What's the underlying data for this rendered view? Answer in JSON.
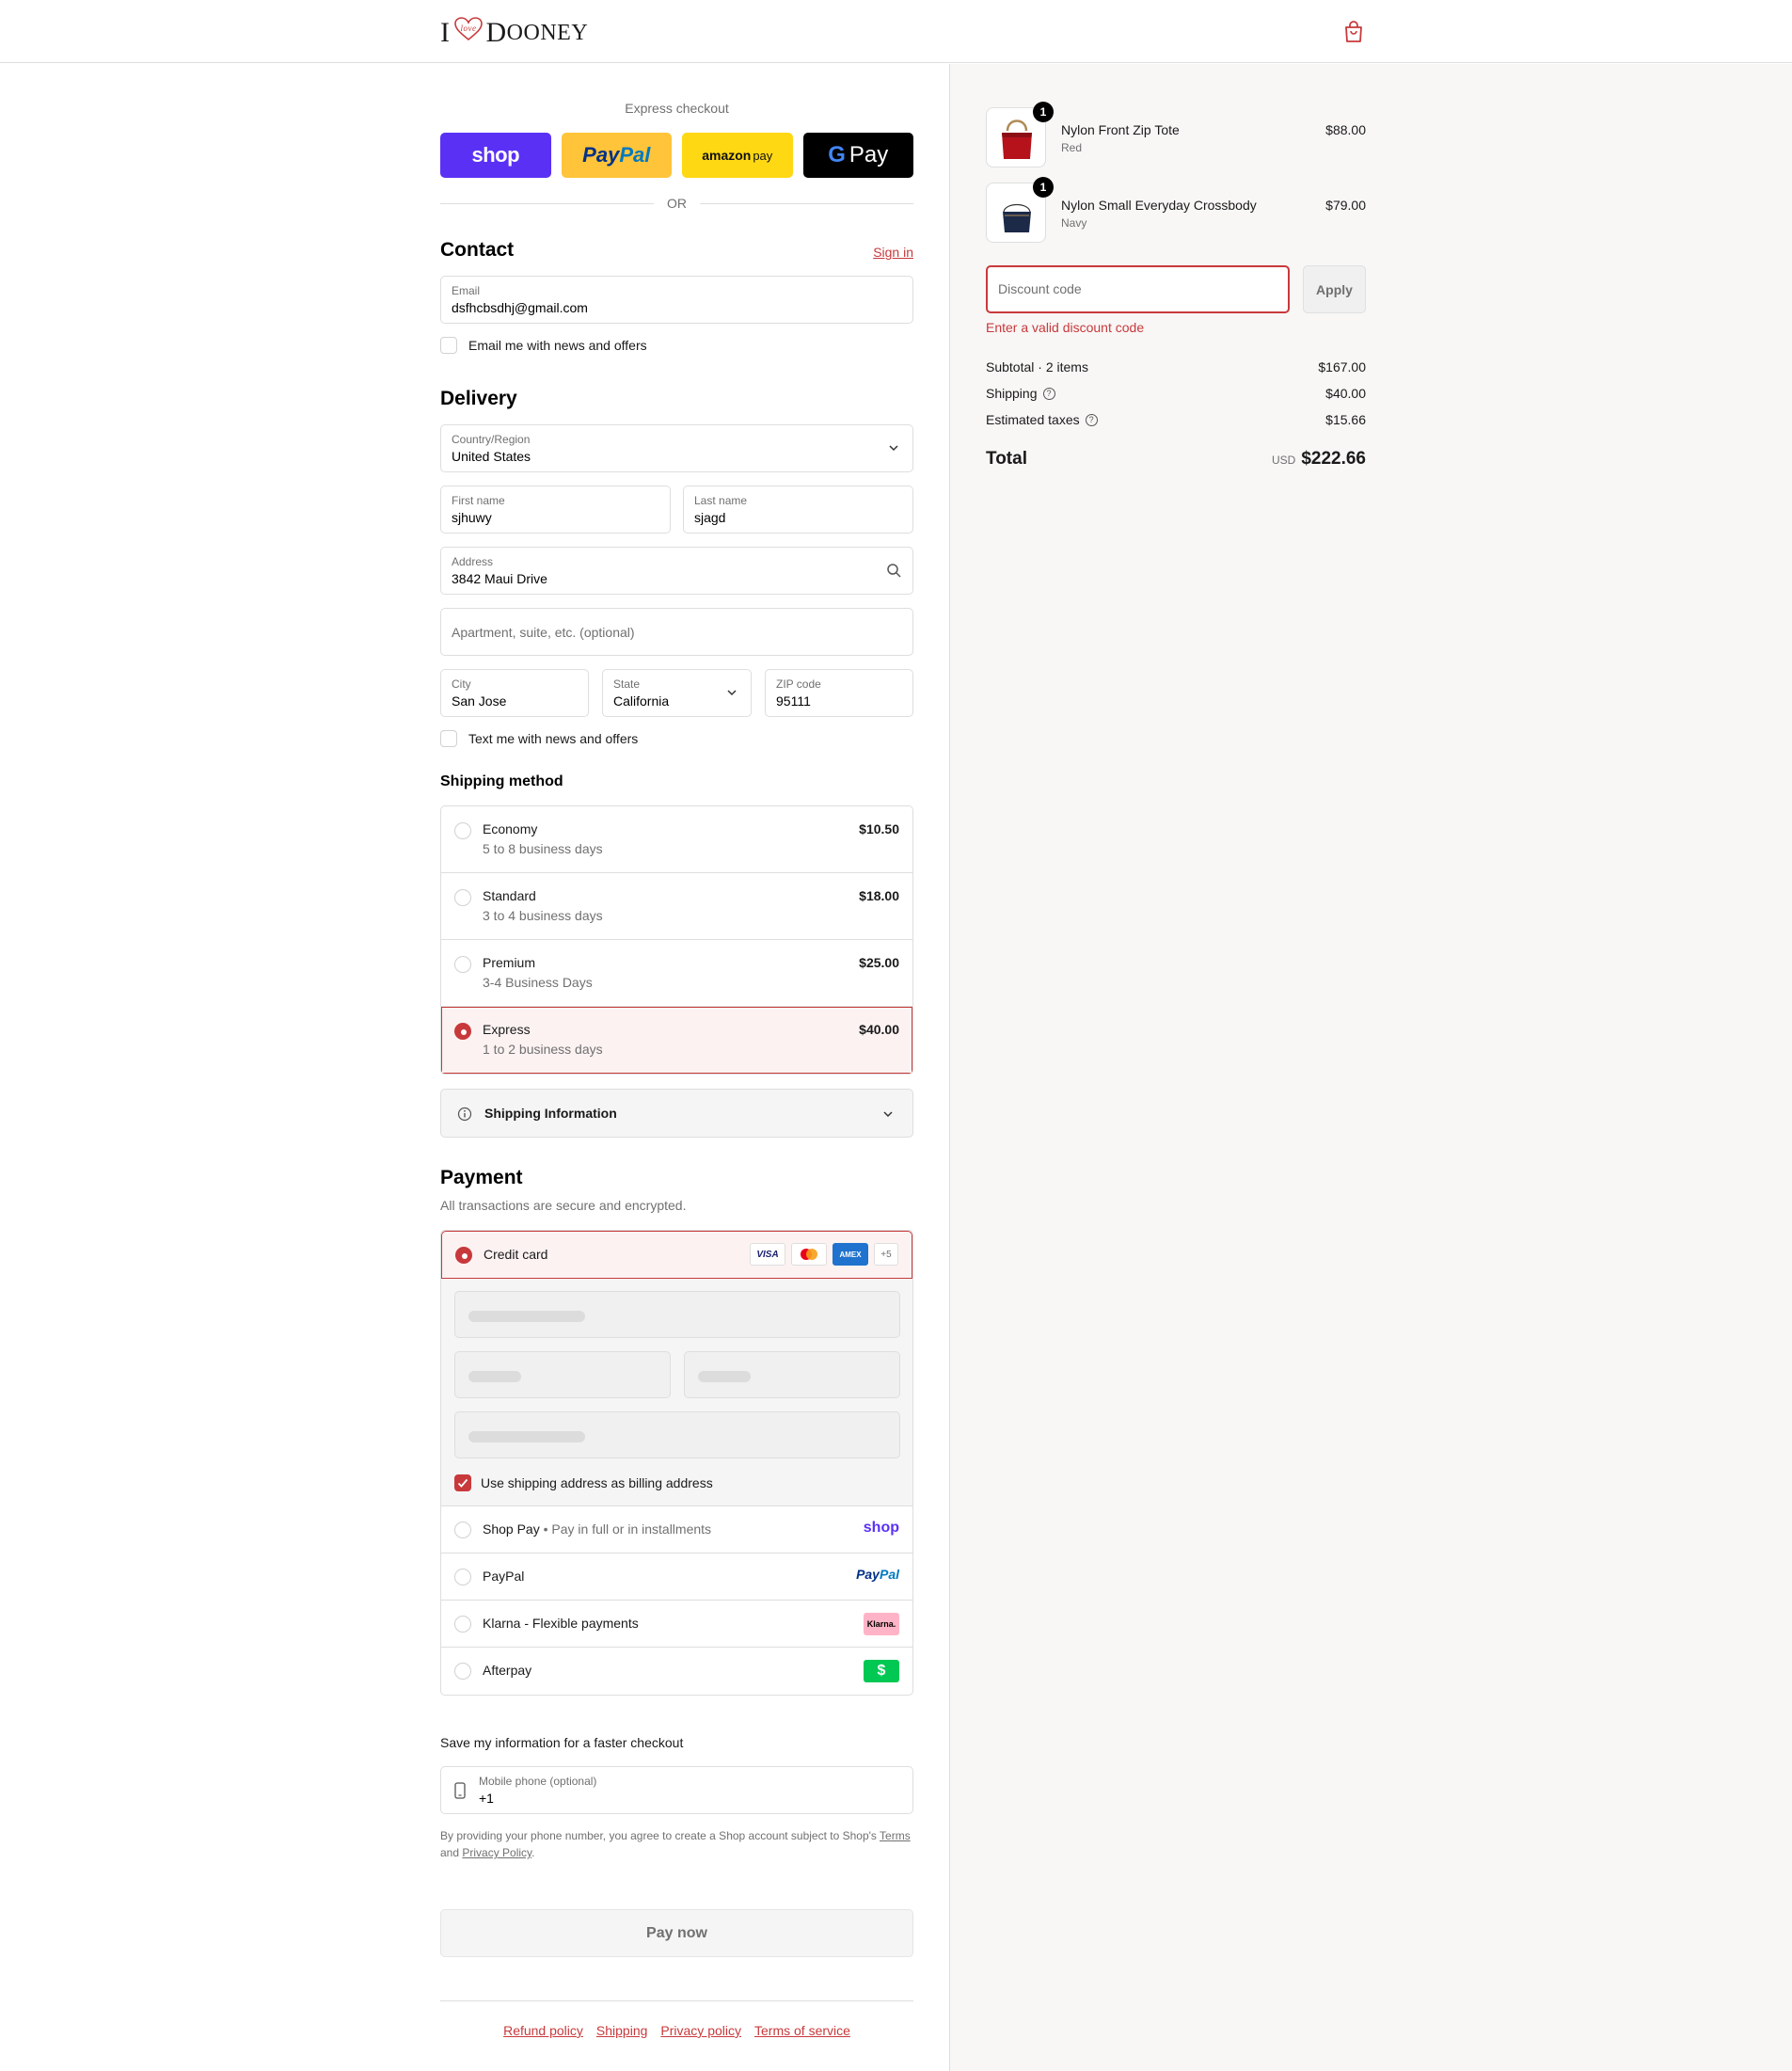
{
  "header": {
    "logo_i": "I",
    "logo_name_first": "D",
    "logo_name_rest": "OONEY",
    "heart_text": "love"
  },
  "express": {
    "title": "Express checkout",
    "shop_label": "shop",
    "paypal_pay": "Pay",
    "paypal_pal": "Pal",
    "amazon_label": "amazon",
    "amazon_pay": "pay",
    "gpay_g": "G",
    "gpay_label": "Pay",
    "or_label": "OR"
  },
  "contact": {
    "title": "Contact",
    "sign_in": "Sign in",
    "email_label": "Email",
    "email_value": "dsfhcbsdhj@gmail.com",
    "news_label": "Email me with news and offers"
  },
  "delivery": {
    "title": "Delivery",
    "country_label": "Country/Region",
    "country_value": "United States",
    "first_label": "First name",
    "first_value": "sjhuwy",
    "last_label": "Last name",
    "last_value": "sjagd",
    "address_label": "Address",
    "address_value": "3842 Maui Drive",
    "apt_placeholder": "Apartment, suite, etc. (optional)",
    "city_label": "City",
    "city_value": "San Jose",
    "state_label": "State",
    "state_value": "California",
    "zip_label": "ZIP code",
    "zip_value": "95111",
    "text_label": "Text me with news and offers"
  },
  "shipping": {
    "title": "Shipping method",
    "options": [
      {
        "name": "Economy",
        "sub": "5 to 8 business days",
        "price": "$10.50"
      },
      {
        "name": "Standard",
        "sub": "3 to 4 business days",
        "price": "$18.00"
      },
      {
        "name": "Premium",
        "sub": "3-4 Business Days",
        "price": "$25.00"
      },
      {
        "name": "Express",
        "sub": "1 to 2 business days",
        "price": "$40.00"
      }
    ],
    "info_label": "Shipping Information"
  },
  "payment": {
    "title": "Payment",
    "subtitle": "All transactions are secure and encrypted.",
    "cc_label": "Credit card",
    "card_visa": "VISA",
    "card_amex": "AMEX",
    "card_more": "+5",
    "billing_label": "Use shipping address as billing address",
    "shoppay_label": "Shop Pay",
    "shoppay_sep": " • ",
    "shoppay_sub": "Pay in full or in installments",
    "shoppay_logo": "shop",
    "paypal_label": "PayPal",
    "paypal_logo_pay": "Pay",
    "paypal_logo_pal": "Pal",
    "klarna_label": "Klarna - Flexible payments",
    "klarna_logo": "Klarna.",
    "afterpay_label": "Afterpay",
    "afterpay_logo": "$"
  },
  "save": {
    "title": "Save my information for a faster checkout",
    "phone_label": "Mobile phone (optional)",
    "phone_value": "+1",
    "disclaimer_pre": "By providing your phone number, you agree to create a Shop account subject to Shop's ",
    "terms": "Terms",
    "and": "and ",
    "privacy": "Privacy Policy",
    "period": "."
  },
  "pay_now": "Pay now",
  "footer": [
    "Refund policy",
    "Shipping",
    "Privacy policy",
    "Terms of service"
  ],
  "cart": {
    "items": [
      {
        "qty": "1",
        "name": "Nylon Front Zip Tote",
        "variant": "Red",
        "price": "$88.00"
      },
      {
        "qty": "1",
        "name": "Nylon Small Everyday Crossbody",
        "variant": "Navy",
        "price": "$79.00"
      }
    ],
    "discount_placeholder": "Discount code",
    "apply": "Apply",
    "discount_error": "Enter a valid discount code",
    "subtotal_label": "Subtotal · 2 items",
    "subtotal": "$167.00",
    "shipping_label": "Shipping",
    "shipping": "$40.00",
    "taxes_label": "Estimated taxes",
    "taxes": "$15.66",
    "total_label": "Total",
    "currency": "USD",
    "total": "$222.66",
    "help_glyph": "?"
  },
  "colors": {
    "accent": "#c8393b",
    "shop": "#5a31f4",
    "paypal": "#ffc439",
    "amazon": "#ffd814",
    "klarna": "#ffb3c7",
    "afterpay": "#00c853"
  },
  "icons": [
    "cart-icon",
    "chevron-down-icon",
    "search-icon",
    "info-icon",
    "help-icon",
    "phone-icon",
    "checkmark-icon"
  ]
}
